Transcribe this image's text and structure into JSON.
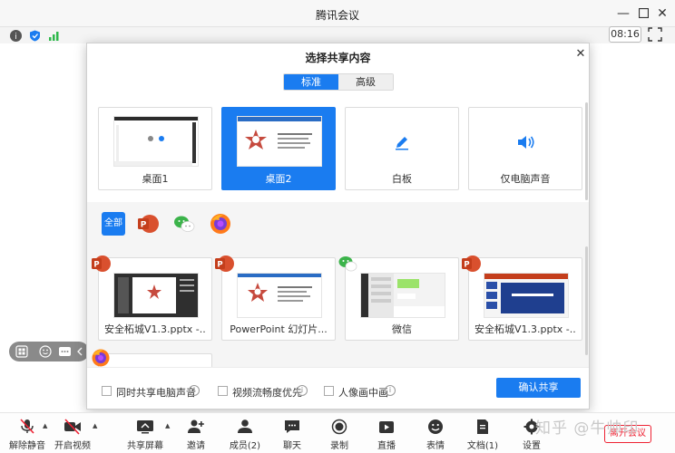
{
  "window": {
    "title": "腾讯会议"
  },
  "status": {
    "clock": "08:16"
  },
  "dialog": {
    "title": "选择共享内容",
    "tabs": [
      {
        "label": "标准"
      },
      {
        "label": "高级"
      }
    ],
    "screens": [
      {
        "label": "桌面1"
      },
      {
        "label": "桌面2"
      },
      {
        "label": "白板"
      },
      {
        "label": "仅电脑声音"
      }
    ],
    "filters": {
      "all_label": "全部"
    },
    "windows": [
      {
        "label": "安全柘城V1.3.pptx -..."
      },
      {
        "label": "PowerPoint 幻灯片..."
      },
      {
        "label": "微信"
      },
      {
        "label": "安全柘城V1.3.pptx -..."
      }
    ],
    "options": [
      {
        "label": "同时共享电脑声音"
      },
      {
        "label": "视频流畅度优先"
      },
      {
        "label": "人像画中画"
      }
    ],
    "confirm_label": "确认共享"
  },
  "toolbar": {
    "items": [
      {
        "label": "解除静音"
      },
      {
        "label": "开启视频"
      },
      {
        "label": "共享屏幕"
      },
      {
        "label": "邀请"
      },
      {
        "label": "成员(2)"
      },
      {
        "label": "聊天"
      },
      {
        "label": "录制"
      },
      {
        "label": "直播"
      },
      {
        "label": "表情"
      },
      {
        "label": "文档(1)"
      },
      {
        "label": "设置"
      }
    ],
    "end_label": "离开会议"
  },
  "watermark": "知乎 @牛帅印",
  "colors": {
    "accent": "#1a7cf0",
    "ppt": "#d9502e",
    "wechat": "#3bb34a"
  }
}
